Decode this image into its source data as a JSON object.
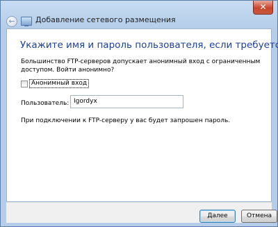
{
  "window": {
    "title": "Добавление сетевого размещения",
    "close_symbol": "✕"
  },
  "icons": {
    "back": "back-arrow-icon",
    "network_location": "network-location-icon",
    "close": "close-icon"
  },
  "content": {
    "heading": "Укажите имя и пароль пользователя, если требуется",
    "description": "Большинство FTP-серверов допускает анонимный вход с ограниченным доступом. Войти анонимно?",
    "anonymous_label": "Анонимный вход",
    "anonymous_checked": false,
    "user_label": "Пользователь:",
    "user_value": "Igordyx",
    "info": "При подключении к FTP-серверу у вас будет запрошен пароль."
  },
  "buttons": {
    "next": "Далее",
    "cancel": "Отмена"
  }
}
